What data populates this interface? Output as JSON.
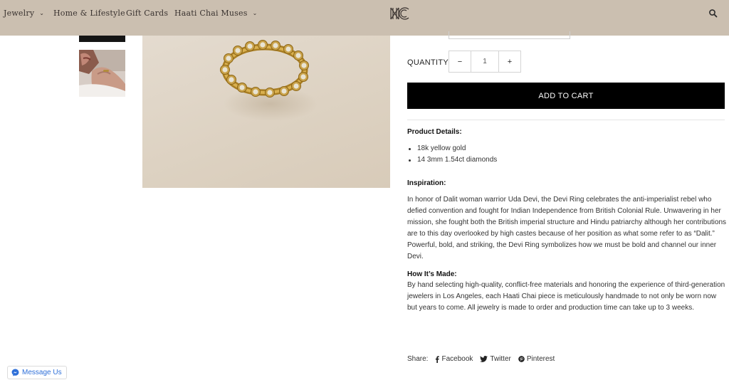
{
  "nav": {
    "items": [
      {
        "label": "Jewelry",
        "has_dropdown": true
      },
      {
        "label": "Home & Lifestyle",
        "has_dropdown": false
      },
      {
        "label": "Gift Cards",
        "has_dropdown": false
      },
      {
        "label": "Haati Chai Muses",
        "has_dropdown": true
      }
    ],
    "logo": "HC",
    "search_icon": "search-icon",
    "colors": {
      "header_bg": "#cbbfb0",
      "nav_text": "#3a3330"
    }
  },
  "product": {
    "quantity_label": "QUANTITY",
    "quantity_value": "1",
    "minus_label": "−",
    "plus_label": "+",
    "add_to_cart_label": "ADD TO CART",
    "details_heading": "Product Details:",
    "details": [
      "18k yellow gold",
      "14 3mm 1.54ct diamonds"
    ],
    "inspiration_heading": "Inspiration:",
    "inspiration_text": "In honor of Dalit woman warrior Uda Devi, the Devi Ring celebrates the anti-imperialist rebel who defied convention and fought for Indian Independence from British Colonial Rule. Unwavering in her mission, she fought both the British imperial structure and Hindu patriarchy although her contributions are to this day overlooked by high castes because of her position as what some refer to as “Dalit.” Powerful, bold, and striking, the Devi Ring symbolizes how we must be bold and channel our inner Devi.",
    "made_heading": "How It’s Made:",
    "made_text": "By hand selecting high-quality, conflict-free materials and honoring the experience of third-generation jewelers in Los Angeles, each Haati Chai piece is meticulously handmade to not only be worn now but years to come. All jewelry is made to order and production time can take up to 3 weeks."
  },
  "share": {
    "label": "Share:",
    "links": [
      {
        "label": "Facebook",
        "icon": "facebook-icon"
      },
      {
        "label": "Twitter",
        "icon": "twitter-icon"
      },
      {
        "label": "Pinterest",
        "icon": "pinterest-icon"
      }
    ]
  },
  "messenger": {
    "label": "Message Us",
    "icon": "messenger-icon",
    "color": "#2e6fd8"
  }
}
